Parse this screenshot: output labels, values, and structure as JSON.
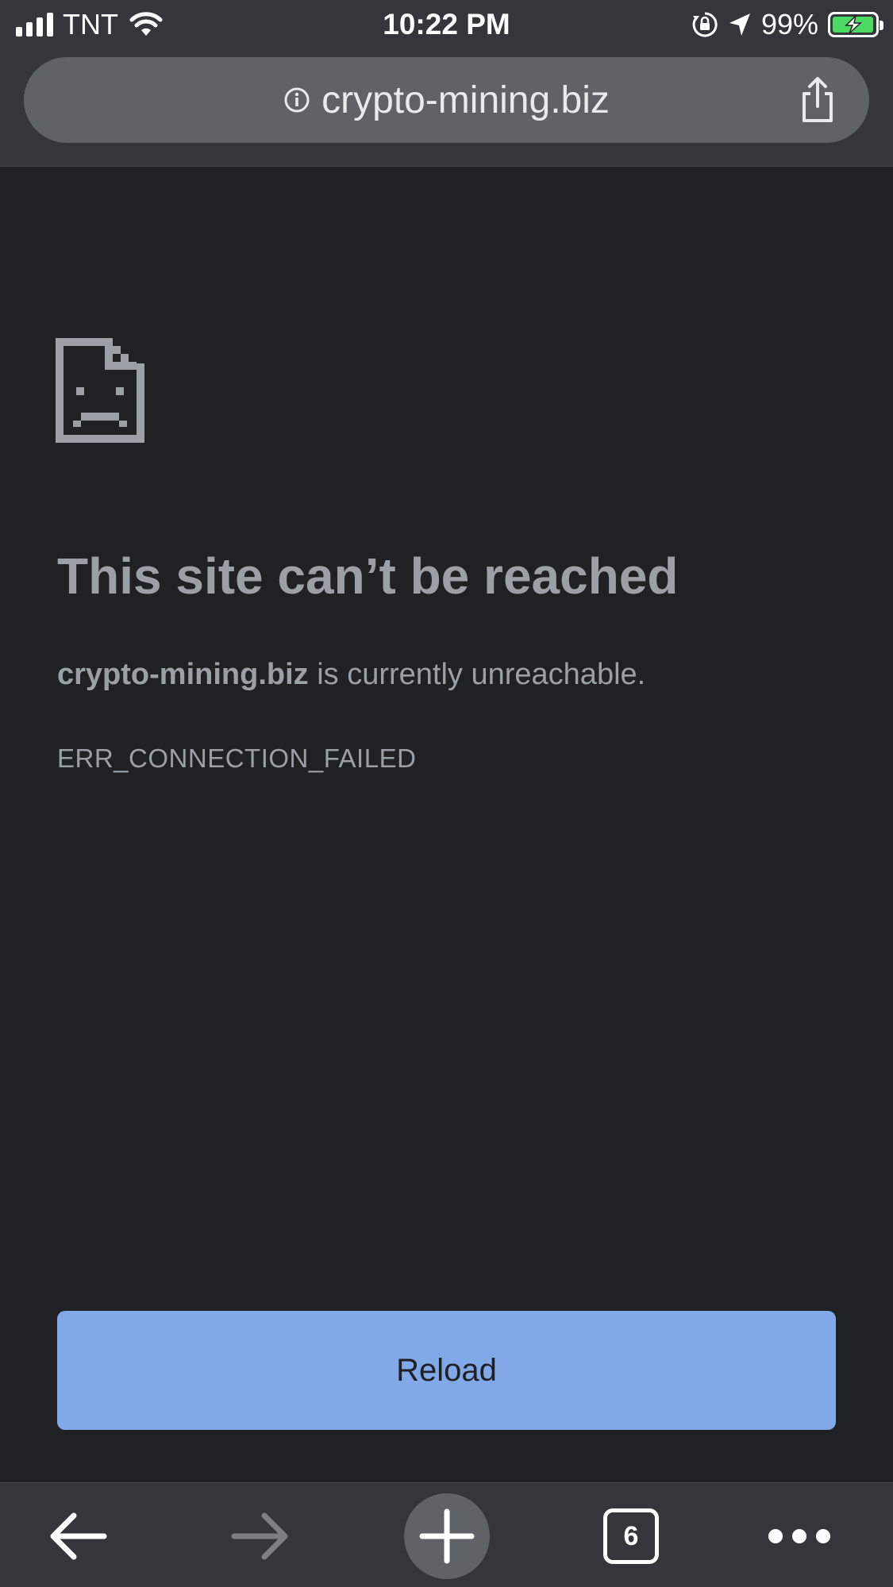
{
  "status_bar": {
    "carrier": "TNT",
    "time": "10:22 PM",
    "battery_percent": "99%",
    "battery_level": 0.99,
    "icons": [
      "signal-icon",
      "wifi-icon",
      "orientation-lock-icon",
      "location-icon",
      "battery-charging-icon"
    ]
  },
  "url_bar": {
    "url": "crypto-mining.biz",
    "icons": [
      "info-icon",
      "share-icon"
    ]
  },
  "error": {
    "icon": "sad-document-icon",
    "title": "This site can’t be reached",
    "host": "crypto-mining.biz",
    "message": " is currently unreachable.",
    "code": "ERR_CONNECTION_FAILED"
  },
  "reload_label": "Reload",
  "toolbar": {
    "tab_count": "6",
    "icons": [
      "back-arrow-icon",
      "forward-arrow-icon",
      "new-tab-plus-icon",
      "tab-switcher-icon",
      "more-dots-icon"
    ]
  },
  "colors": {
    "background": "#202124",
    "chrome": "#35363a",
    "url_pill": "#5f6368",
    "text_muted": "#9aa0a6",
    "accent": "#8ab4f8",
    "battery_green": "#4cd964"
  }
}
